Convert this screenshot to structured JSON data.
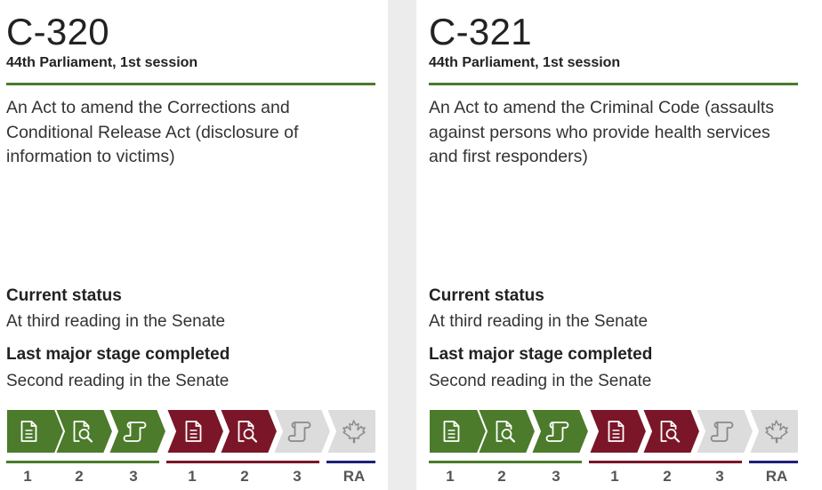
{
  "colors": {
    "house_green": "#4b7b2b",
    "senate_red": "#7a1628",
    "royal_assent_blue": "#1f1f7a",
    "pending_grey": "#dcdcdc"
  },
  "bills": [
    {
      "number": "C-320",
      "session": "44th Parliament, 1st session",
      "title": "An Act to amend the Corrections and Conditional Release Act (disclosure of information to victims)",
      "current_status_label": "Current status",
      "current_status": "At third reading in the Senate",
      "last_stage_label": "Last major stage completed",
      "last_stage": "Second reading in the Senate",
      "stage_labels": [
        "1",
        "2",
        "3",
        "1",
        "2",
        "3",
        "RA"
      ],
      "stage_icons": [
        "document-icon",
        "document-search-icon",
        "scroll-icon",
        "document-icon",
        "document-search-icon",
        "scroll-icon",
        "maple-leaf-icon"
      ],
      "stage_states": [
        "complete",
        "complete",
        "complete",
        "complete",
        "complete",
        "pending",
        "pending"
      ]
    },
    {
      "number": "C-321",
      "session": "44th Parliament, 1st session",
      "title": "An Act to amend the Criminal Code (assaults against persons who provide health services and first responders)",
      "current_status_label": "Current status",
      "current_status": "At third reading in the Senate",
      "last_stage_label": "Last major stage completed",
      "last_stage": "Second reading in the Senate",
      "stage_labels": [
        "1",
        "2",
        "3",
        "1",
        "2",
        "3",
        "RA"
      ],
      "stage_icons": [
        "document-icon",
        "document-search-icon",
        "scroll-icon",
        "document-icon",
        "document-search-icon",
        "scroll-icon",
        "maple-leaf-icon"
      ],
      "stage_states": [
        "complete",
        "complete",
        "complete",
        "complete",
        "complete",
        "pending",
        "pending"
      ]
    }
  ]
}
